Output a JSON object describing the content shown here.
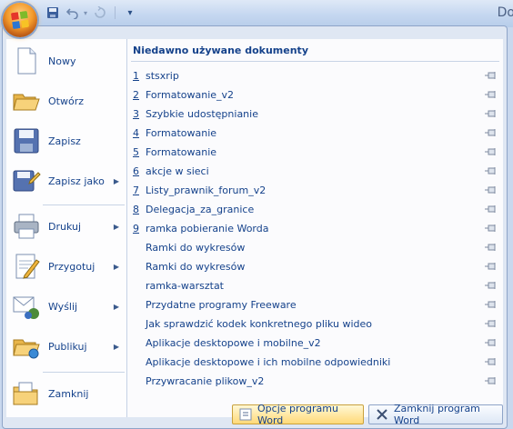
{
  "window": {
    "title_fragment": "Do"
  },
  "quick_access": {
    "save_icon": "save-icon",
    "undo_icon": "undo-icon",
    "redo_icon": "redo-icon",
    "customize_icon": "customize-arrow-icon"
  },
  "left_menu": [
    {
      "label": "Nowy",
      "icon": "new-document-icon",
      "submenu": false
    },
    {
      "label": "Otwórz",
      "icon": "open-folder-icon",
      "submenu": false
    },
    {
      "label": "Zapisz",
      "icon": "save-icon",
      "submenu": false
    },
    {
      "label": "Zapisz jako",
      "icon": "save-as-icon",
      "submenu": true
    },
    {
      "label": "Drukuj",
      "icon": "printer-icon",
      "submenu": true
    },
    {
      "label": "Przygotuj",
      "icon": "prepare-icon",
      "submenu": true
    },
    {
      "label": "Wyślij",
      "icon": "send-icon",
      "submenu": true
    },
    {
      "label": "Publikuj",
      "icon": "publish-icon",
      "submenu": true
    },
    {
      "label": "Zamknij",
      "icon": "close-folder-icon",
      "submenu": false
    }
  ],
  "recent": {
    "heading": "Niedawno używane dokumenty",
    "items": [
      {
        "num": "1",
        "name": "stsxrip"
      },
      {
        "num": "2",
        "name": "Formatowanie_v2"
      },
      {
        "num": "3",
        "name": "Szybkie udostępnianie"
      },
      {
        "num": "4",
        "name": "Formatowanie"
      },
      {
        "num": "5",
        "name": "Formatowanie"
      },
      {
        "num": "6",
        "name": "akcje w sieci"
      },
      {
        "num": "7",
        "name": "Listy_prawnik_forum_v2"
      },
      {
        "num": "8",
        "name": "Delegacja_za_granice"
      },
      {
        "num": "9",
        "name": "ramka pobieranie Worda"
      },
      {
        "num": "",
        "name": "Ramki do wykresów"
      },
      {
        "num": "",
        "name": "Ramki do wykresów"
      },
      {
        "num": "",
        "name": "ramka-warsztat"
      },
      {
        "num": "",
        "name": "Przydatne programy Freeware"
      },
      {
        "num": "",
        "name": "Jak sprawdzić kodek konkretnego pliku wideo"
      },
      {
        "num": "",
        "name": "Aplikacje desktopowe i mobilne_v2"
      },
      {
        "num": "",
        "name": "Aplikacje desktopowe i ich mobilne odpowiedniki"
      },
      {
        "num": "",
        "name": "Przywracanie plikow_v2"
      }
    ]
  },
  "bottom": {
    "options_label": "Opcje programu Word",
    "exit_label": "Zamknij program Word"
  }
}
